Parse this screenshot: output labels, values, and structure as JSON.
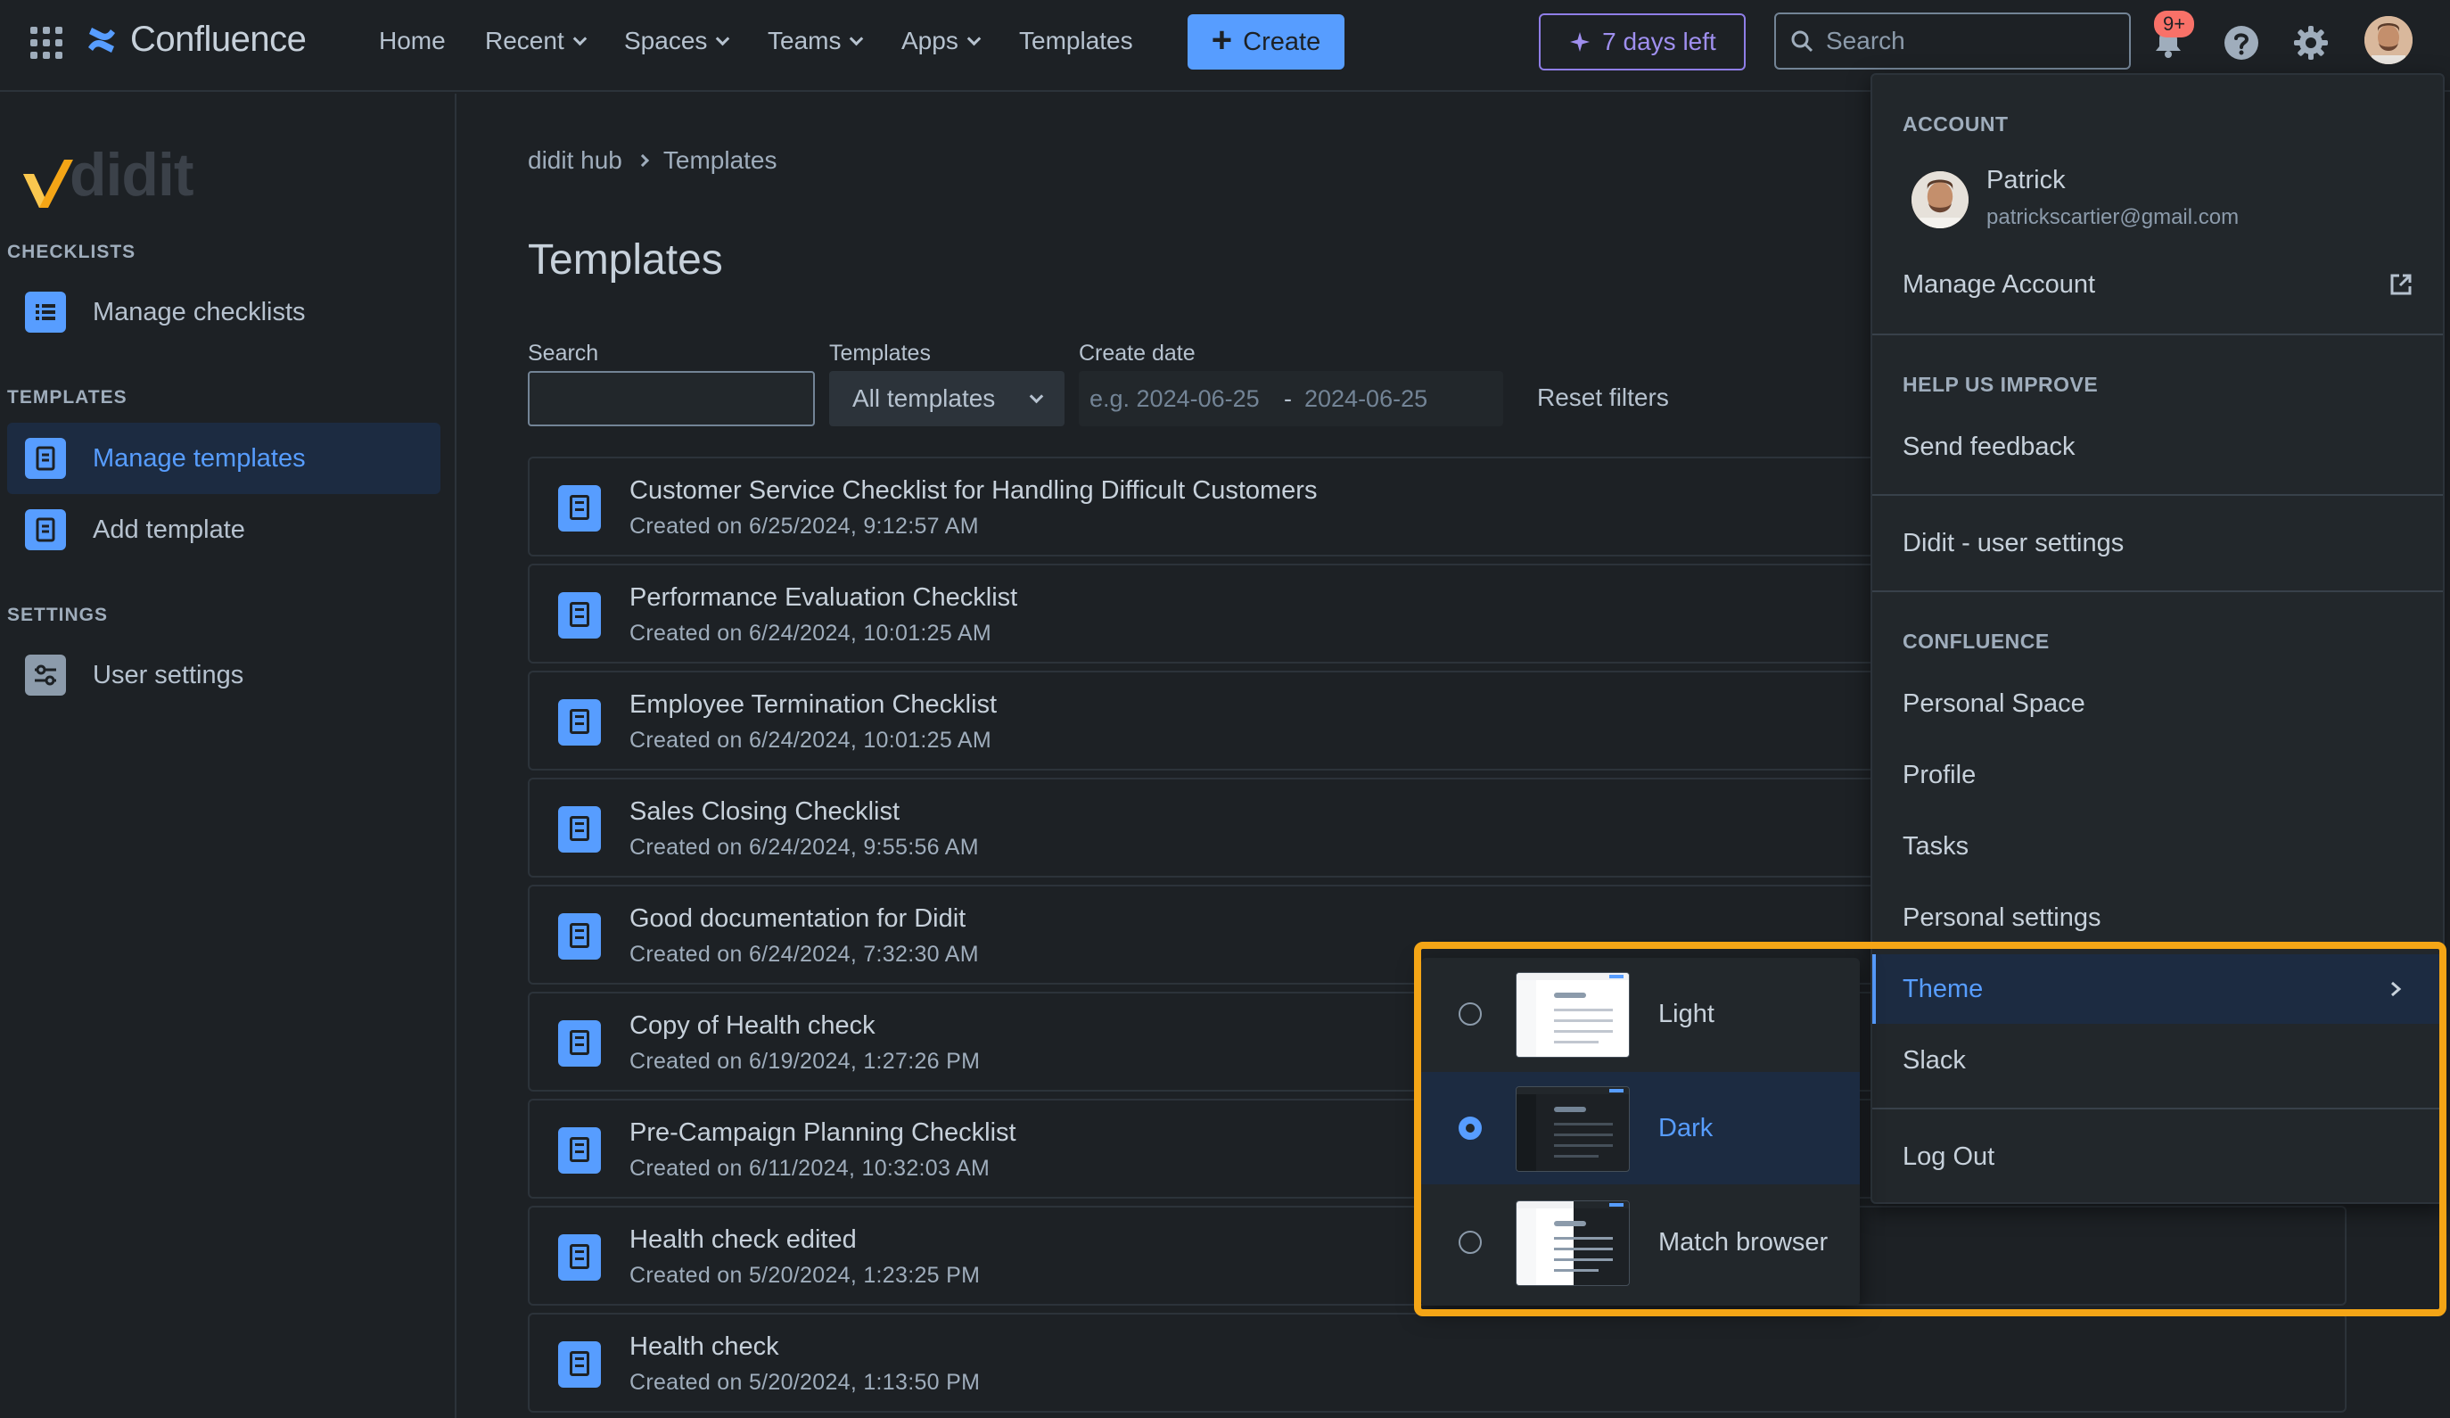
{
  "topnav": {
    "logo_text": "Confluence",
    "links": [
      "Home",
      "Recent",
      "Spaces",
      "Teams",
      "Apps",
      "Templates"
    ],
    "create_label": "Create",
    "trial_label": "7 days left",
    "search_placeholder": "Search",
    "notification_badge": "9+",
    "icons": [
      "app-switcher-icon",
      "confluence-logo-icon",
      "search-icon",
      "notifications-icon",
      "help-icon",
      "settings-icon",
      "sparkle-icon"
    ]
  },
  "sidebar": {
    "brand": "didit",
    "sections": [
      {
        "heading": "CHECKLISTS",
        "items": [
          {
            "label": "Manage checklists",
            "icon": "checklist-icon"
          }
        ]
      },
      {
        "heading": "TEMPLATES",
        "items": [
          {
            "label": "Manage templates",
            "icon": "template-icon",
            "active": true
          },
          {
            "label": "Add template",
            "icon": "template-icon"
          }
        ]
      },
      {
        "heading": "SETTINGS",
        "items": [
          {
            "label": "User settings",
            "icon": "sliders-icon"
          }
        ]
      }
    ]
  },
  "main": {
    "breadcrumb": [
      "didit hub",
      "Templates"
    ],
    "title": "Templates",
    "filters": {
      "search_label": "Search",
      "templates_label": "Templates",
      "templates_value": "All templates",
      "date_label": "Create date",
      "date_from_placeholder": "e.g. 2024-06-25",
      "date_sep": "-",
      "date_to_placeholder": "2024-06-25",
      "reset_label": "Reset filters"
    },
    "rows": [
      {
        "title": "Customer Service Checklist for Handling Difficult Customers",
        "created": "Created on 6/25/2024, 9:12:57 AM"
      },
      {
        "title": "Performance Evaluation Checklist",
        "created": "Created on 6/24/2024, 10:01:25 AM"
      },
      {
        "title": "Employee Termination Checklist",
        "created": "Created on 6/24/2024, 10:01:25 AM"
      },
      {
        "title": "Sales Closing Checklist",
        "created": "Created on 6/24/2024, 9:55:56 AM"
      },
      {
        "title": "Good documentation for Didit",
        "created": "Created on 6/24/2024, 7:32:30 AM"
      },
      {
        "title": "Copy of Health check",
        "created": "Created on 6/19/2024, 1:27:26 PM"
      },
      {
        "title": "Pre-Campaign Planning Checklist",
        "created": "Created on 6/11/2024, 10:32:03 AM"
      },
      {
        "title": "Health check edited",
        "created": "Created on 5/20/2024, 1:23:25 PM"
      },
      {
        "title": "Health check",
        "created": "Created on 5/20/2024, 1:13:50 PM"
      }
    ]
  },
  "account_menu": {
    "account_heading": "ACCOUNT",
    "user_name": "Patrick",
    "user_email": "patrickscartier@gmail.com",
    "manage_account": "Manage Account",
    "help_heading": "HELP US IMPROVE",
    "send_feedback": "Send feedback",
    "didit_settings": "Didit - user settings",
    "confluence_heading": "CONFLUENCE",
    "personal_space": "Personal Space",
    "profile": "Profile",
    "tasks": "Tasks",
    "personal_settings": "Personal settings",
    "theme": "Theme",
    "slack": "Slack",
    "log_out": "Log Out"
  },
  "theme_submenu": {
    "options": [
      {
        "label": "Light",
        "selected": false
      },
      {
        "label": "Dark",
        "selected": true
      },
      {
        "label": "Match browser",
        "selected": false
      }
    ]
  },
  "colors": {
    "accent": "#579dff",
    "highlight": "#f4a516",
    "trial": "#9f8fef",
    "badge": "#f87168"
  }
}
